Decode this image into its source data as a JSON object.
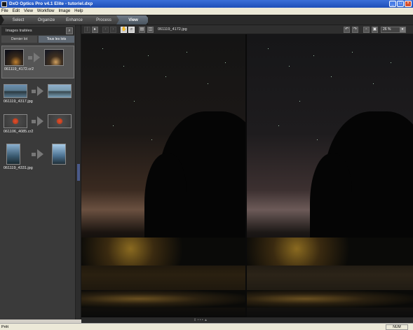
{
  "window": {
    "title": "DxO Optics Pro v4.1 Elite - tutoriel.dxp",
    "controls": [
      "_",
      "□",
      "×"
    ]
  },
  "menu": [
    "File",
    "Edit",
    "View",
    "Workflow",
    "Image",
    "Help"
  ],
  "workflow_tabs": [
    {
      "label": "Select",
      "active": false
    },
    {
      "label": "Organize",
      "active": false
    },
    {
      "label": "Enhance",
      "active": false
    },
    {
      "label": "Process",
      "active": false
    },
    {
      "label": "View",
      "active": true
    }
  ],
  "left_panel": {
    "header": "Images traitées",
    "tabs": [
      {
        "label": "Dernier lot",
        "active": false
      },
      {
        "label": "Tous les lots",
        "active": true
      }
    ],
    "thumbnails": [
      {
        "name": "061119_4172.cr2",
        "selected": true
      },
      {
        "name": "061119_4317.jpg",
        "selected": false
      },
      {
        "name": "061106_4085.cr2",
        "selected": false
      },
      {
        "name": "061119_4331.jpg",
        "selected": false
      }
    ]
  },
  "viewer": {
    "filename": "061119_4172.jpg",
    "zoom": "26 %",
    "toolbar_icons": [
      "first-icon",
      "prev-icon",
      "back-icon",
      "forward-icon",
      "hand-icon",
      "zoom-icon",
      "single-view-icon",
      "split-view-icon",
      "rotate-left-icon",
      "rotate-right-icon",
      "fit-icon",
      "actual-size-icon"
    ]
  },
  "status": {
    "text": "Prêt",
    "num": "NUM"
  },
  "colors": {
    "title_bar": "#1e4fb8",
    "active_tab": "#5d6670",
    "panel_bg": "#3a3a3a"
  }
}
